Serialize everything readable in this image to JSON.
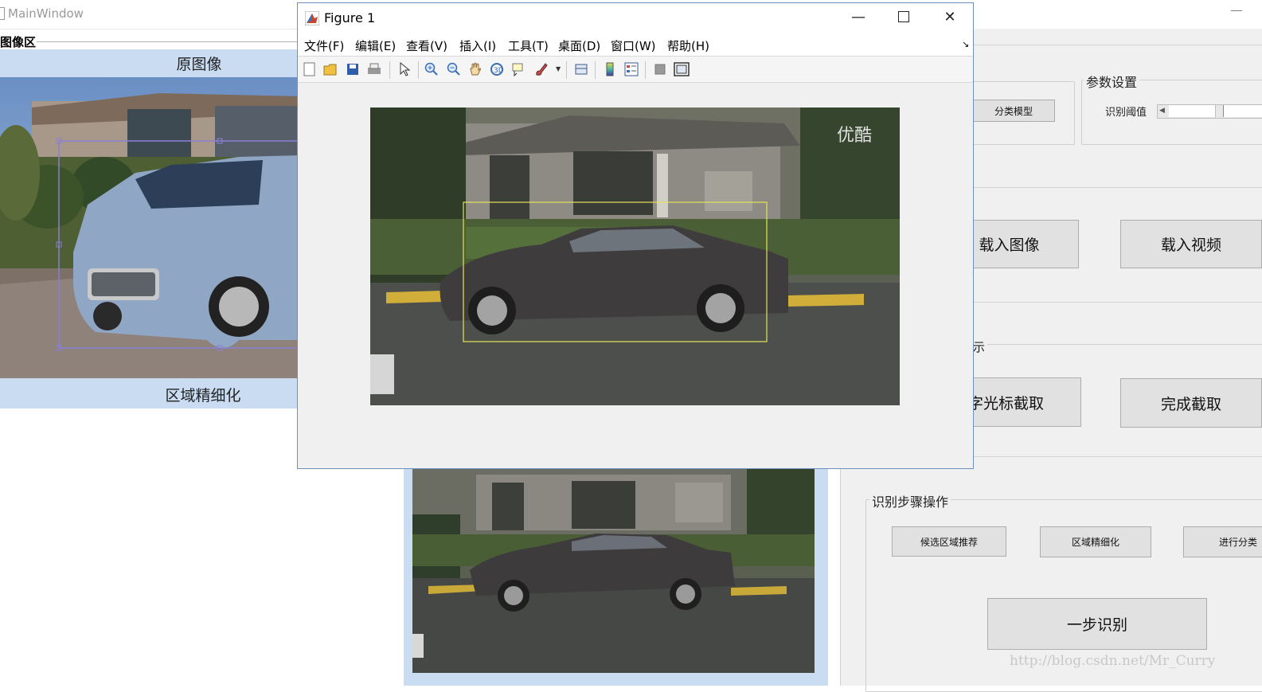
{
  "main_window": {
    "title": "MainWindow",
    "image_panel": {
      "title": "图像区",
      "original_label": "原图像",
      "refine_label": "区域精细化"
    },
    "param_panel": {
      "title": "参数设置",
      "threshold_label": "识别阈值",
      "classify_button": "分类模型"
    },
    "load_image_button": "载入图像",
    "load_video_button": "载入视频",
    "partial_section_char": "示",
    "crosshair_capture_button": "十字光标截取",
    "finish_capture_button": "完成截取",
    "steps_panel": {
      "title": "识别步骤操作",
      "candidate_button": "候选区域推荐",
      "refine_button": "区域精细化",
      "classify_button": "进行分类",
      "one_step_button": "一步识别"
    }
  },
  "figure_window": {
    "title": "Figure 1",
    "menu": [
      "文件(F)",
      "编辑(E)",
      "查看(V)",
      "插入(I)",
      "工具(T)",
      "桌面(D)",
      "窗口(W)",
      "帮助(H)"
    ],
    "image_logo_text": "优酷",
    "toolbar_icons": [
      "new-icon",
      "open-icon",
      "save-icon",
      "print-icon",
      "pointer-icon",
      "zoom-in-icon",
      "zoom-out-icon",
      "pan-icon",
      "rotate-icon",
      "datatip-icon",
      "brush-icon",
      "link-icon",
      "colorbar-icon",
      "legend-icon",
      "hide-plot-icon",
      "show-plot-icon"
    ]
  },
  "watermark": "http://blog.csdn.net/Mr_Curry",
  "colors": {
    "panel_blue": "#c9dcf2",
    "dialog_gray": "#f0f0f0",
    "button_gray": "#e1e1e1",
    "box_yellow": "#e6e35a",
    "selection_purple": "#8a7fd6"
  }
}
